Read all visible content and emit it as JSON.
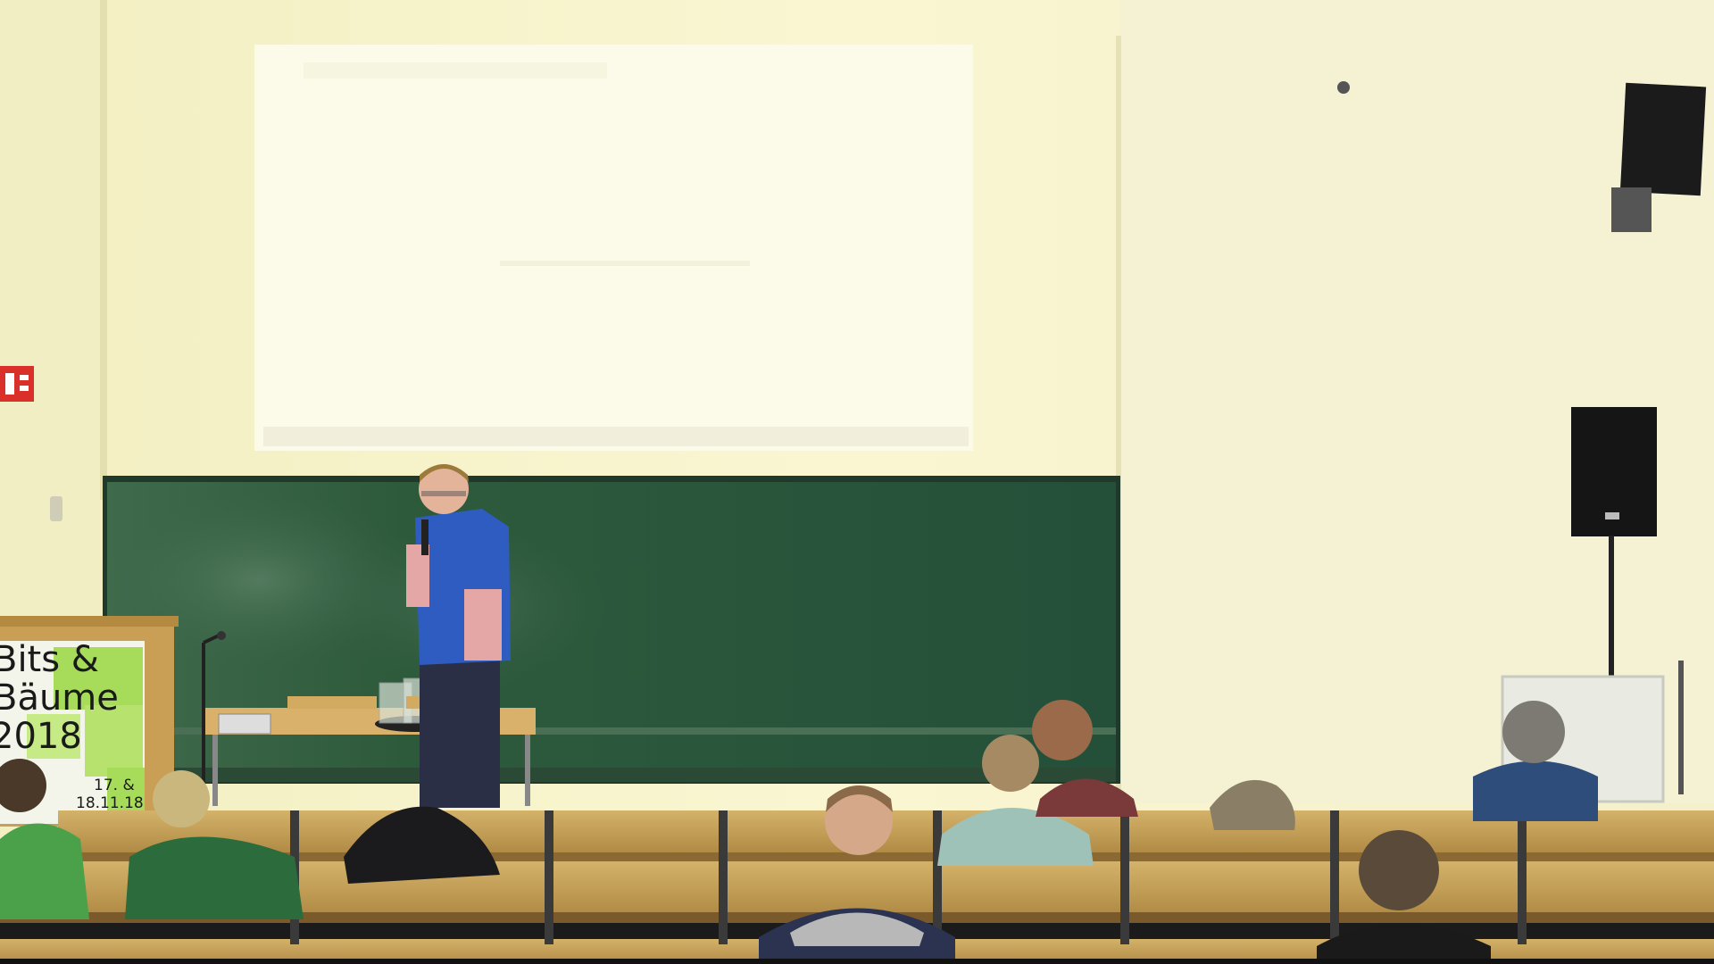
{
  "scene": {
    "description_free": true,
    "colors": {
      "wall": "#f6f2c8",
      "screen": "#fbf9e4",
      "chalkboard": "#2f5a3d",
      "seat_wood": "#c9a45c",
      "banner_green": "#a6dc5a"
    }
  },
  "banner": {
    "line1": "Bits &",
    "line2": "Bäume",
    "line3": "2018",
    "date1": "17. &",
    "date2": "18.11.18"
  },
  "icons": {
    "fire_sign": "fire-extinguisher-sign-icon",
    "smoke_detector": "smoke-detector-icon"
  }
}
